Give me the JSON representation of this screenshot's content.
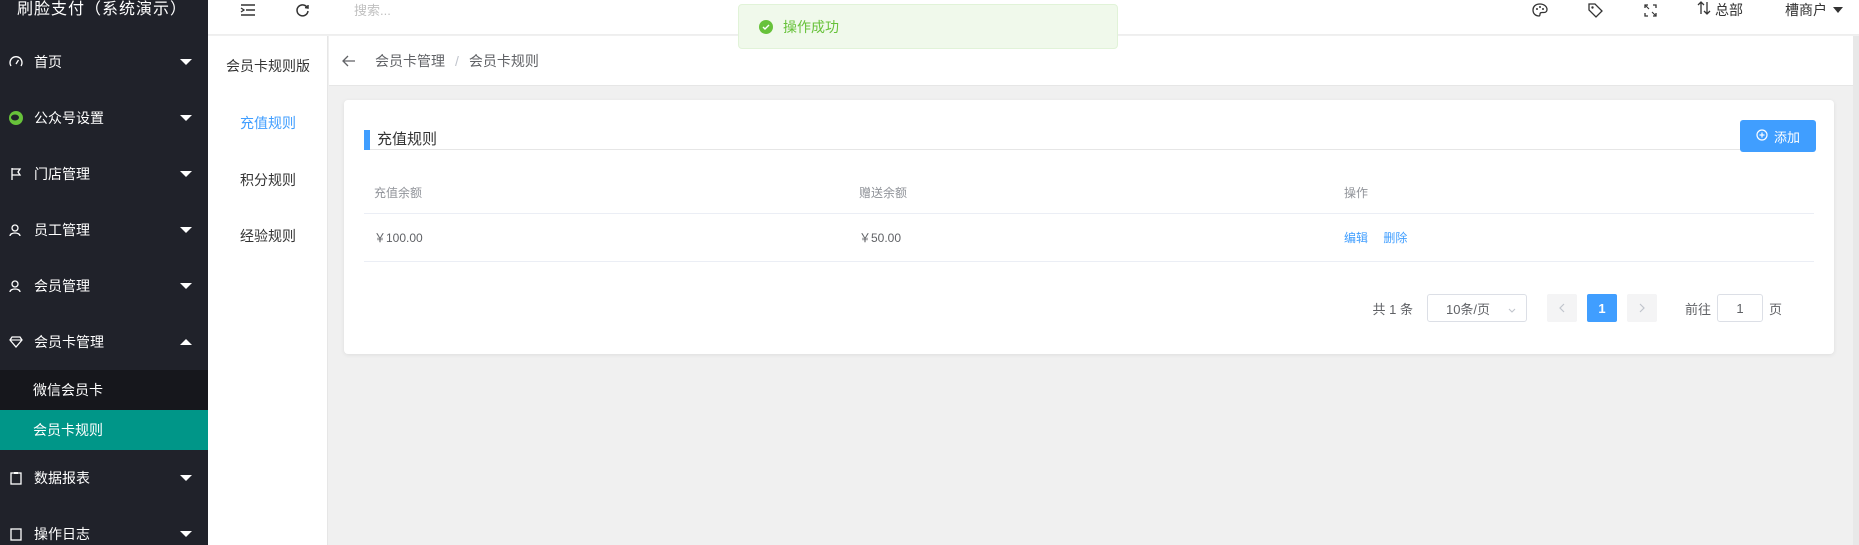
{
  "app": {
    "title": "刷脸支付（系统演示）"
  },
  "sidebar": {
    "items": [
      {
        "label": "首页",
        "icon": "gauge-icon"
      },
      {
        "label": "公众号设置",
        "icon": "wechat-icon"
      },
      {
        "label": "门店管理",
        "icon": "flag-icon"
      },
      {
        "label": "员工管理",
        "icon": "user-icon"
      },
      {
        "label": "会员管理",
        "icon": "user-icon"
      },
      {
        "label": "会员卡管理",
        "icon": "diamond-icon"
      },
      {
        "label": "数据报表",
        "icon": "clipboard-icon"
      },
      {
        "label": "操作日志",
        "icon": "log-icon"
      }
    ],
    "submenu": [
      {
        "label": "微信会员卡"
      },
      {
        "label": "会员卡规则"
      }
    ]
  },
  "header": {
    "search_placeholder": "搜索...",
    "hq_label": "总部",
    "user_label": "槽商户"
  },
  "toast": {
    "message": "操作成功"
  },
  "subnav": {
    "title": "会员卡规则版",
    "items": [
      {
        "label": "充值规则"
      },
      {
        "label": "积分规则"
      },
      {
        "label": "经验规则"
      }
    ]
  },
  "breadcrumb": {
    "items": [
      "会员卡管理",
      "会员卡规则"
    ],
    "separator": "/"
  },
  "card": {
    "title": "充值规则",
    "add_label": "添加"
  },
  "table": {
    "columns": [
      "充值余额",
      "赠送余额",
      "操作"
    ],
    "rows": [
      {
        "recharge": "￥100.00",
        "bonus": "￥50.00",
        "edit": "编辑",
        "delete": "删除"
      }
    ]
  },
  "pagination": {
    "total": "共 1 条",
    "page_size": "10条/页",
    "current_page": "1",
    "goto_label": "前往",
    "goto_value": "1",
    "page_unit": "页"
  },
  "colors": {
    "primary": "#409eff",
    "sidebar_bg": "#20222a",
    "active_teal": "#009688",
    "success": "#67c23a"
  }
}
